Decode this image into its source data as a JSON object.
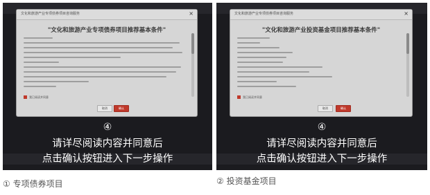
{
  "colors": {
    "accent": "#c0392b",
    "panel_bg": "#1b1b1f",
    "dialog_bg": "#d6d6d6",
    "caption": "#555555"
  },
  "icons": {
    "close": "close-icon",
    "checkbox": "checkbox-icon"
  },
  "panels": [
    {
      "dialog_title": "文化和旅游产业专项债券项目咨询服务",
      "close_glyph": "×",
      "heading": "\"文化和旅游产业专项债券项目推荐基本条件\"",
      "agree_label": "我已阅读并同意",
      "cancel_label": "取消",
      "ok_label": "确认",
      "step_number": "④",
      "overlay_line1": "请详尽阅读内容并同意后",
      "overlay_line2": "点击确认按钮进入下一步操作",
      "caption": "① 专项债券项目"
    },
    {
      "dialog_title": "文化和旅游产业专项债券项目咨询服务",
      "close_glyph": "×",
      "heading": "\"文化和旅游产业投资基金项目推荐基本条件\"",
      "agree_label": "我已阅读并同意",
      "cancel_label": "取消",
      "ok_label": "确认",
      "step_number": "④",
      "overlay_line1": "请详尽阅读内容并同意后",
      "overlay_line2": "点击确认按钮进入下一步操作",
      "caption": "② 投资基金项目"
    }
  ]
}
